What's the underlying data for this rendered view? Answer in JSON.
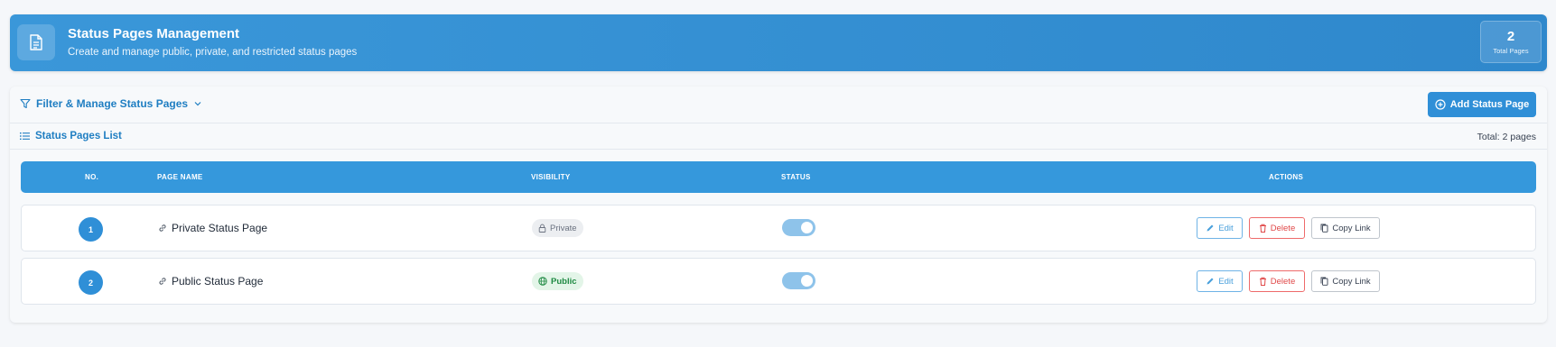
{
  "header": {
    "title": "Status Pages Management",
    "subtitle": "Create and manage public, private, and restricted status pages",
    "stat_value": "2",
    "stat_label": "Total Pages"
  },
  "filter": {
    "label": "Filter & Manage Status Pages",
    "add_button_label": "Add Status Page"
  },
  "list": {
    "title": "Status Pages List",
    "total": "Total: 2 pages"
  },
  "table": {
    "columns": [
      "NO.",
      "PAGE NAME",
      "VISIBILITY",
      "STATUS",
      "ACTIONS"
    ],
    "rows": [
      {
        "no": "1",
        "name": "Private Status Page",
        "visibility": "Private",
        "status_on": true
      },
      {
        "no": "2",
        "name": "Public Status Page",
        "visibility": "Public",
        "status_on": true
      }
    ],
    "actions": {
      "edit": "Edit",
      "delete": "Delete",
      "copy": "Copy Link"
    }
  },
  "colors": {
    "primary": "#2f8fd7",
    "danger": "#e04848",
    "public_green": "#1f8a43"
  }
}
